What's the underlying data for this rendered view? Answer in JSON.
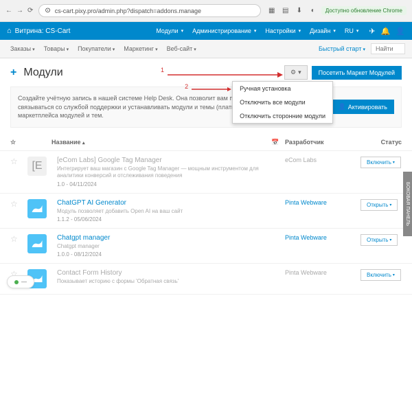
{
  "browser": {
    "url": "cs-cart.pixy.pro/admin.php?dispatch=addons.manage",
    "chrome_update": "Доступно обновление Chrome"
  },
  "topbar": {
    "store": "Витрина: CS-Cart",
    "menu": [
      "Модули",
      "Администрирование",
      "Настройки",
      "Дизайн",
      "RU"
    ]
  },
  "subbar": {
    "items": [
      "Заказы",
      "Товары",
      "Покупатели",
      "Маркетинг",
      "Веб-сайт"
    ],
    "quick_start": "Быстрый старт",
    "search": "Найти"
  },
  "page": {
    "title": "Модули",
    "visit_market": "Посетить Маркет Модулей",
    "dropdown": [
      "Ручная установка",
      "Отключить все модули",
      "Отключить сторонние модули"
    ]
  },
  "info": {
    "text": "Создайте учётную запись в нашей системе Help Desk. Она позволит вам получать обновления магазина, связываться со службой поддержки и устанавливать модули и темы (платные или бесплатные) с нашего маркетплейса модулей и тем.",
    "activate": "Активировать"
  },
  "headers": {
    "name": "Название",
    "developer": "Разработчик",
    "status": "Статус"
  },
  "addons": [
    {
      "name": "[eCom Labs] Google Tag Manager",
      "desc": "Интегрирует ваш магазин с Google Tag Manager — мощным инструментом для аналитики конверсий и отслеживания поведения",
      "ver": "1.0 - 04/11/2024",
      "dev": "eCom Labs",
      "action": "Включить",
      "icon": "E",
      "gray": true
    },
    {
      "name": "ChatGPT AI Generator",
      "desc": "Модуль позволяет добавить Open AI на ваш сайт",
      "ver": "1.1.2 - 05/06/2024",
      "dev": "Pinta Webware",
      "action": "Открыть",
      "icon": "blue"
    },
    {
      "name": "Chatgpt manager",
      "desc": "Chatgpt manager",
      "ver": "1.0.0 - 08/12/2024",
      "dev": "Pinta Webware",
      "action": "Открыть",
      "icon": "blue"
    },
    {
      "name": "Contact Form History",
      "desc": "Показывает историю с формы 'Обратная связь'",
      "ver": "",
      "dev": "Pinta Webware",
      "action": "Включить",
      "icon": "blue",
      "gray": true
    }
  ],
  "side_tab": "БОКОВАЯ ПАНЕЛЬ"
}
